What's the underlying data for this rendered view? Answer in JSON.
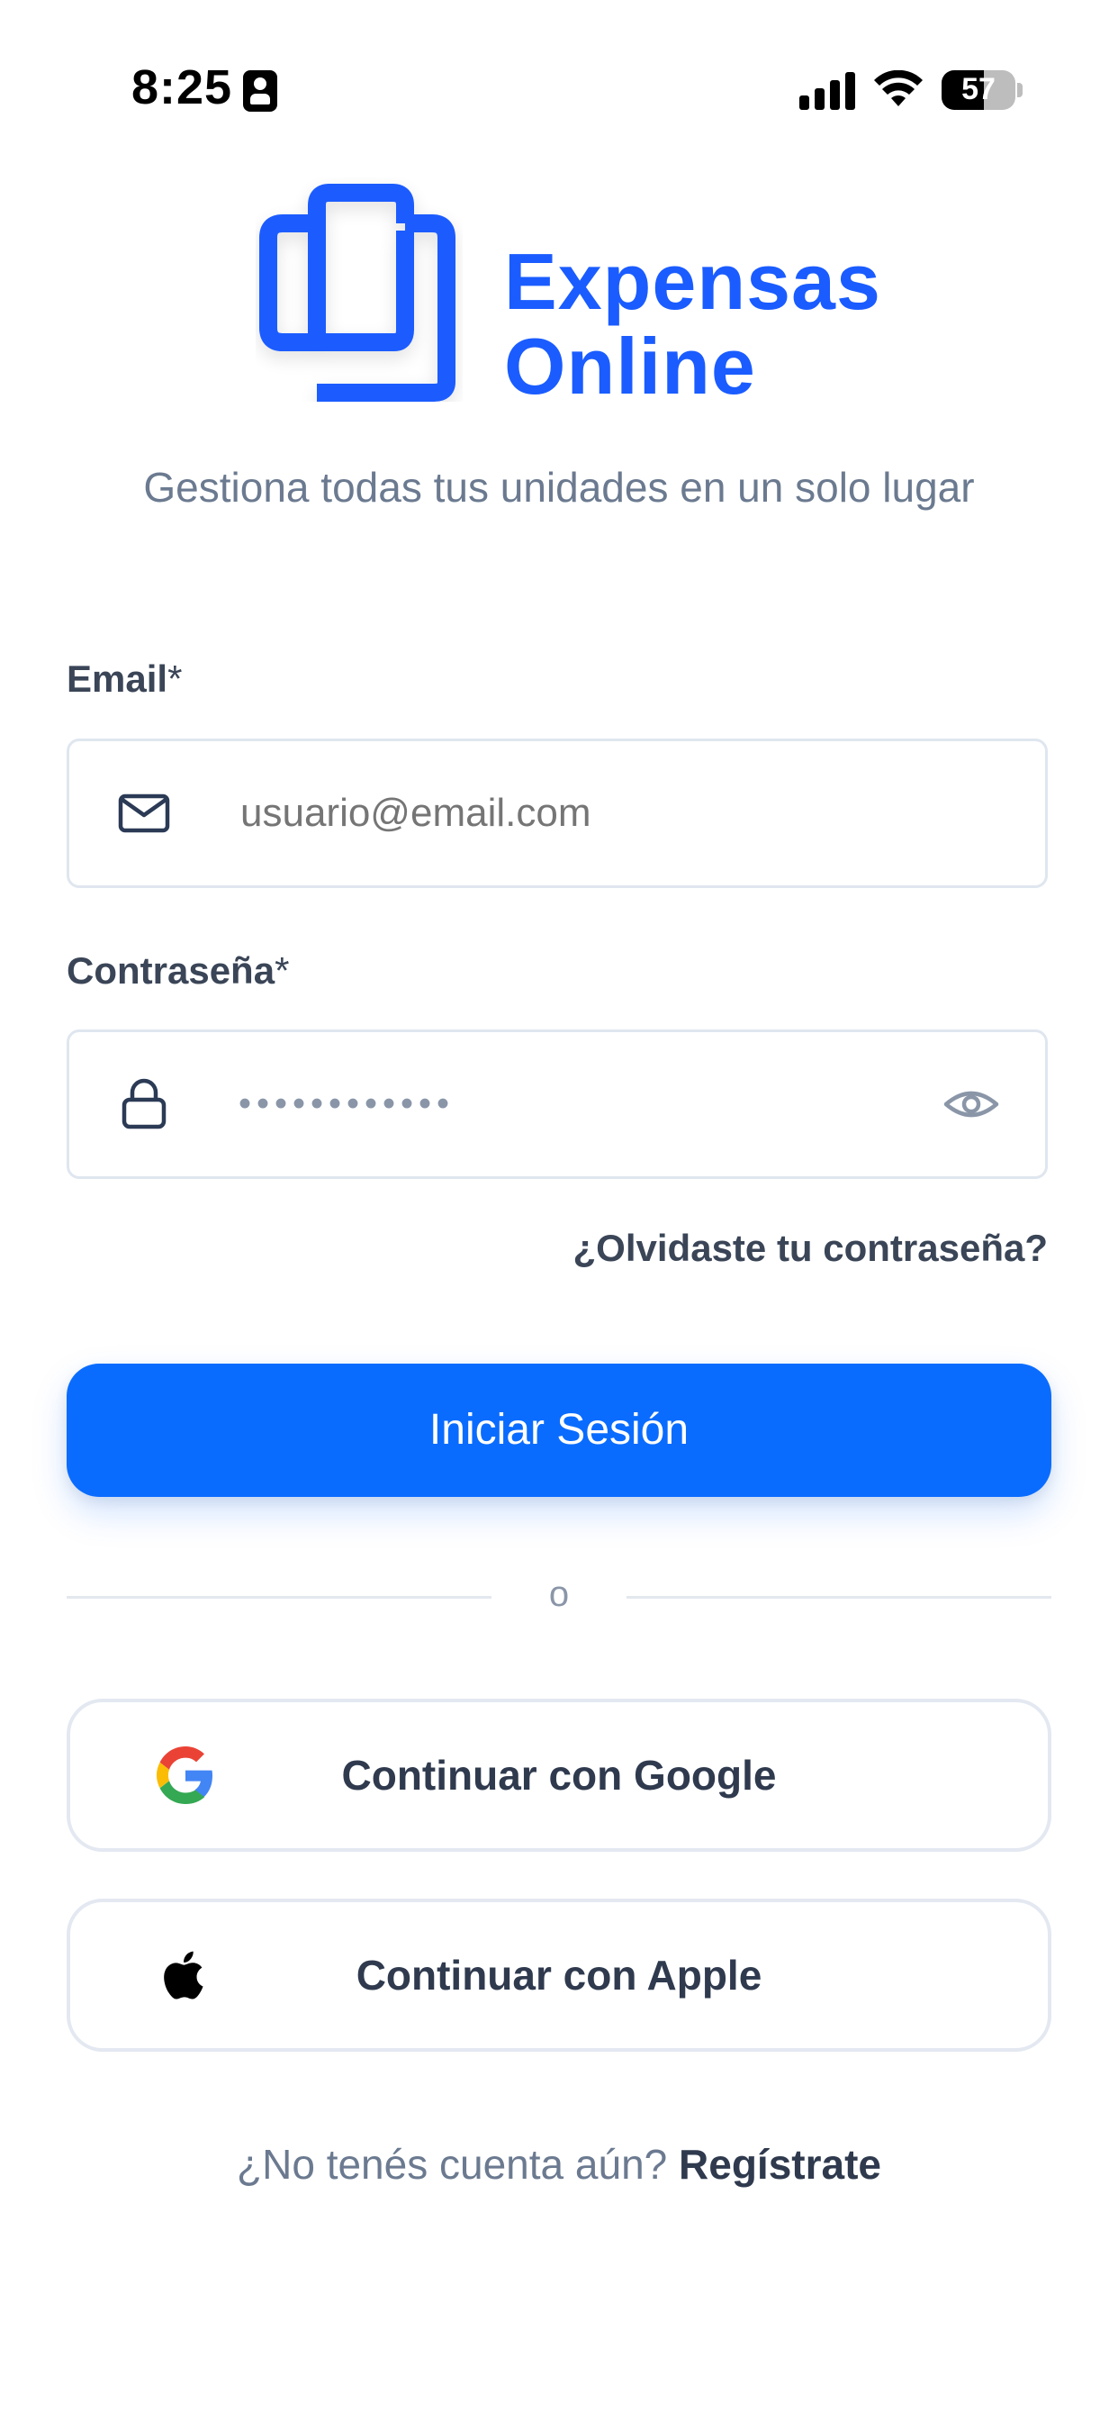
{
  "status_bar": {
    "time": "8:25",
    "battery": "57",
    "battery_level": 0.57
  },
  "brand": {
    "name_line1": "Expensas",
    "name_line2": "Online",
    "tagline": "Gestiona todas tus unidades en un solo lugar",
    "color": "#1a5cff"
  },
  "form": {
    "email_label": "Email",
    "email_required": "*",
    "email_placeholder": "usuario@email.com",
    "password_label": "Contraseña",
    "password_required": "*",
    "password_value": "••••••••••••",
    "forgot_password": "¿Olvidaste tu contraseña?",
    "submit_label": "Iniciar Sesión",
    "submit_color": "#0a6cff"
  },
  "divider": {
    "text": "o"
  },
  "social": {
    "google_label": "Continuar con Google",
    "apple_label": "Continuar con Apple"
  },
  "signup": {
    "prompt": "¿No tenés cuenta aún?",
    "link": "Regístrate"
  },
  "icons": {
    "email": "mail-icon",
    "password": "lock-icon",
    "toggle_visibility": "eye-icon",
    "google": "google-icon",
    "apple": "apple-icon"
  }
}
